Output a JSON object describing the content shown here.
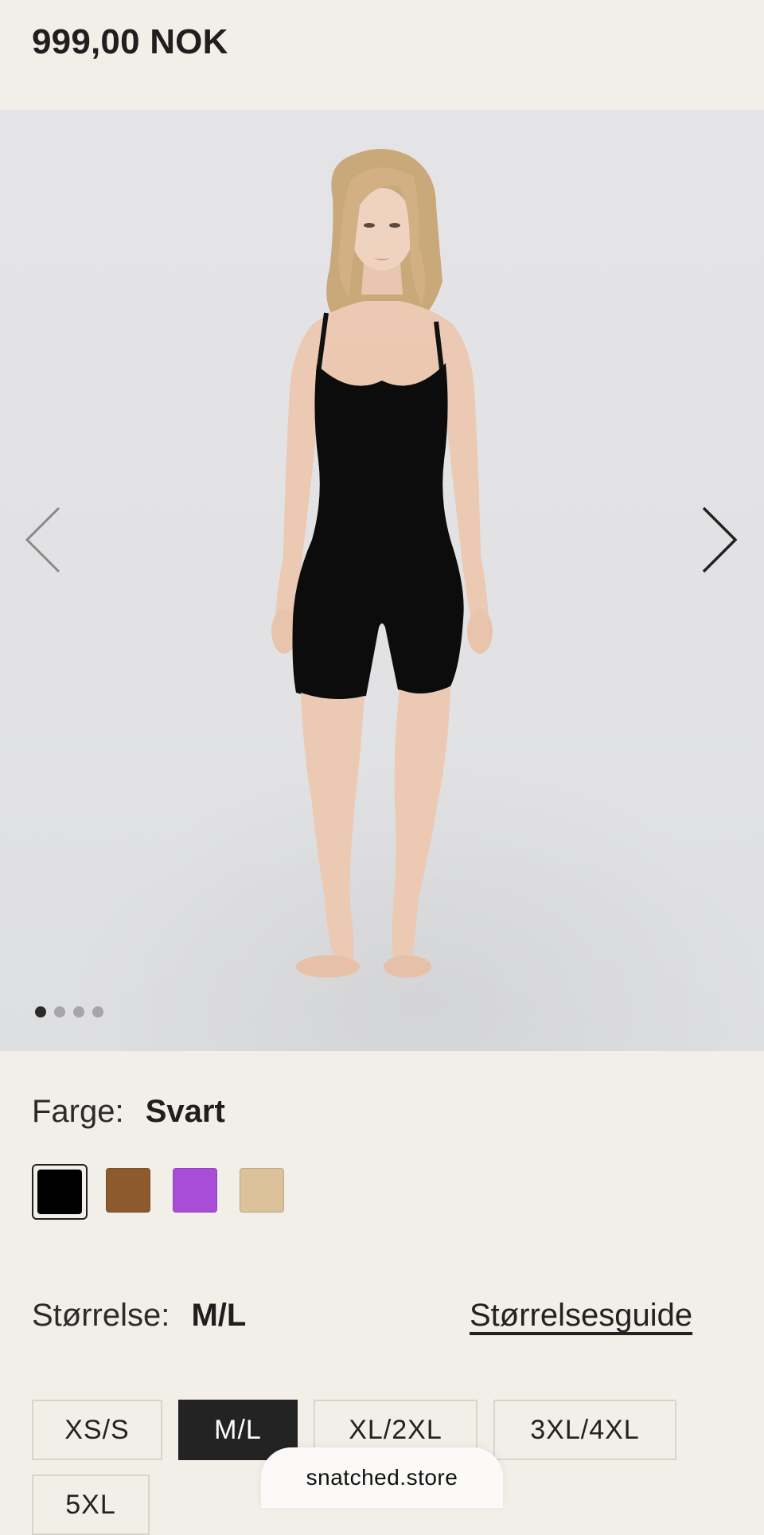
{
  "price": "999,00 NOK",
  "gallery": {
    "image_alt": "Model wearing black bodysuit",
    "current_index": 1,
    "total": 4,
    "colors": {
      "background": "#e3e3e5",
      "garment": "#0c0c0c"
    }
  },
  "color": {
    "label": "Farge:",
    "selected": "Svart",
    "swatches": [
      {
        "name": "black",
        "hex": "#000000"
      },
      {
        "name": "brown",
        "hex": "#8c5a2c"
      },
      {
        "name": "purple",
        "hex": "#a84dd8"
      },
      {
        "name": "beige",
        "hex": "#dcc19a"
      }
    ]
  },
  "size": {
    "label": "Størrelse:",
    "selected": "M/L",
    "guide_label": "Størrelsesguide",
    "options": [
      "XS/S",
      "M/L",
      "XL/2XL",
      "3XL/4XL",
      "5XL"
    ]
  },
  "footer": {
    "domain": "snatched.store"
  }
}
